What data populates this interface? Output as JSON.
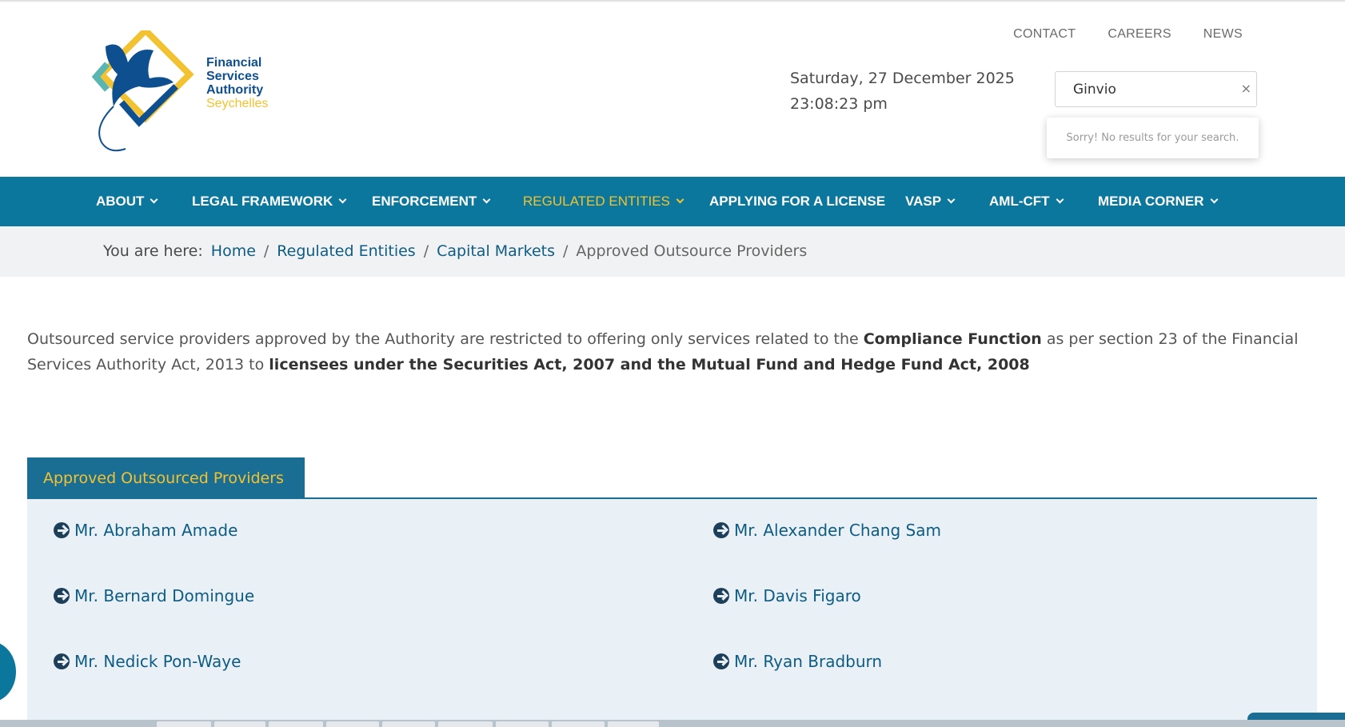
{
  "header": {
    "logo": {
      "line1": "Financial",
      "line2": "Services",
      "line3": "Authority",
      "line4": "Seychelles"
    },
    "top_links": [
      "CONTACT",
      "CAREERS",
      "NEWS"
    ],
    "date": "Saturday, 27 December 2025",
    "time": "23:08:23 pm",
    "search": {
      "value": "Ginvio",
      "clear_glyph": "×",
      "no_results": "Sorry! No results for your search."
    }
  },
  "nav": {
    "items": [
      {
        "label": "ABOUT",
        "has_dropdown": true
      },
      {
        "label": "LEGAL FRAMEWORK",
        "has_dropdown": true
      },
      {
        "label": "ENFORCEMENT",
        "has_dropdown": true
      },
      {
        "label": "REGULATED ENTITIES",
        "has_dropdown": true,
        "active": true
      },
      {
        "label": "APPLYING FOR A LICENSE",
        "has_dropdown": false
      },
      {
        "label": "VASP",
        "has_dropdown": true
      },
      {
        "label": "AML-CFT",
        "has_dropdown": true
      },
      {
        "label": "MEDIA CORNER",
        "has_dropdown": true
      }
    ]
  },
  "breadcrumb": {
    "prefix": "You are here:",
    "links": [
      "Home",
      "Regulated Entities",
      "Capital Markets"
    ],
    "separator": "/",
    "current": "Approved Outsource Providers"
  },
  "intro": {
    "part1": "Outsourced service providers approved by the Authority are restricted to offering only services related to the ",
    "bold1": "Compliance Function",
    "part2": " as per section 23 of the Financial Services Authority Act, 2013 to ",
    "bold2": "licensees under the Securities Act, 2007 and the Mutual Fund and Hedge Fund Act, 2008"
  },
  "tab": {
    "label": "Approved Outsourced Providers"
  },
  "providers": [
    "Mr. Abraham Amade",
    "Mr. Alexander Chang Sam",
    "Mr. Bernard Domingue",
    "Mr. Davis Figaro",
    "Mr. Nedick Pon-Waye",
    "Mr. Ryan Bradburn"
  ],
  "colors": {
    "nav_bg": "#0b779c",
    "accent_yellow": "#f2c230",
    "link_blue": "#0e5c84",
    "panel_bg": "#e9f1f6"
  }
}
